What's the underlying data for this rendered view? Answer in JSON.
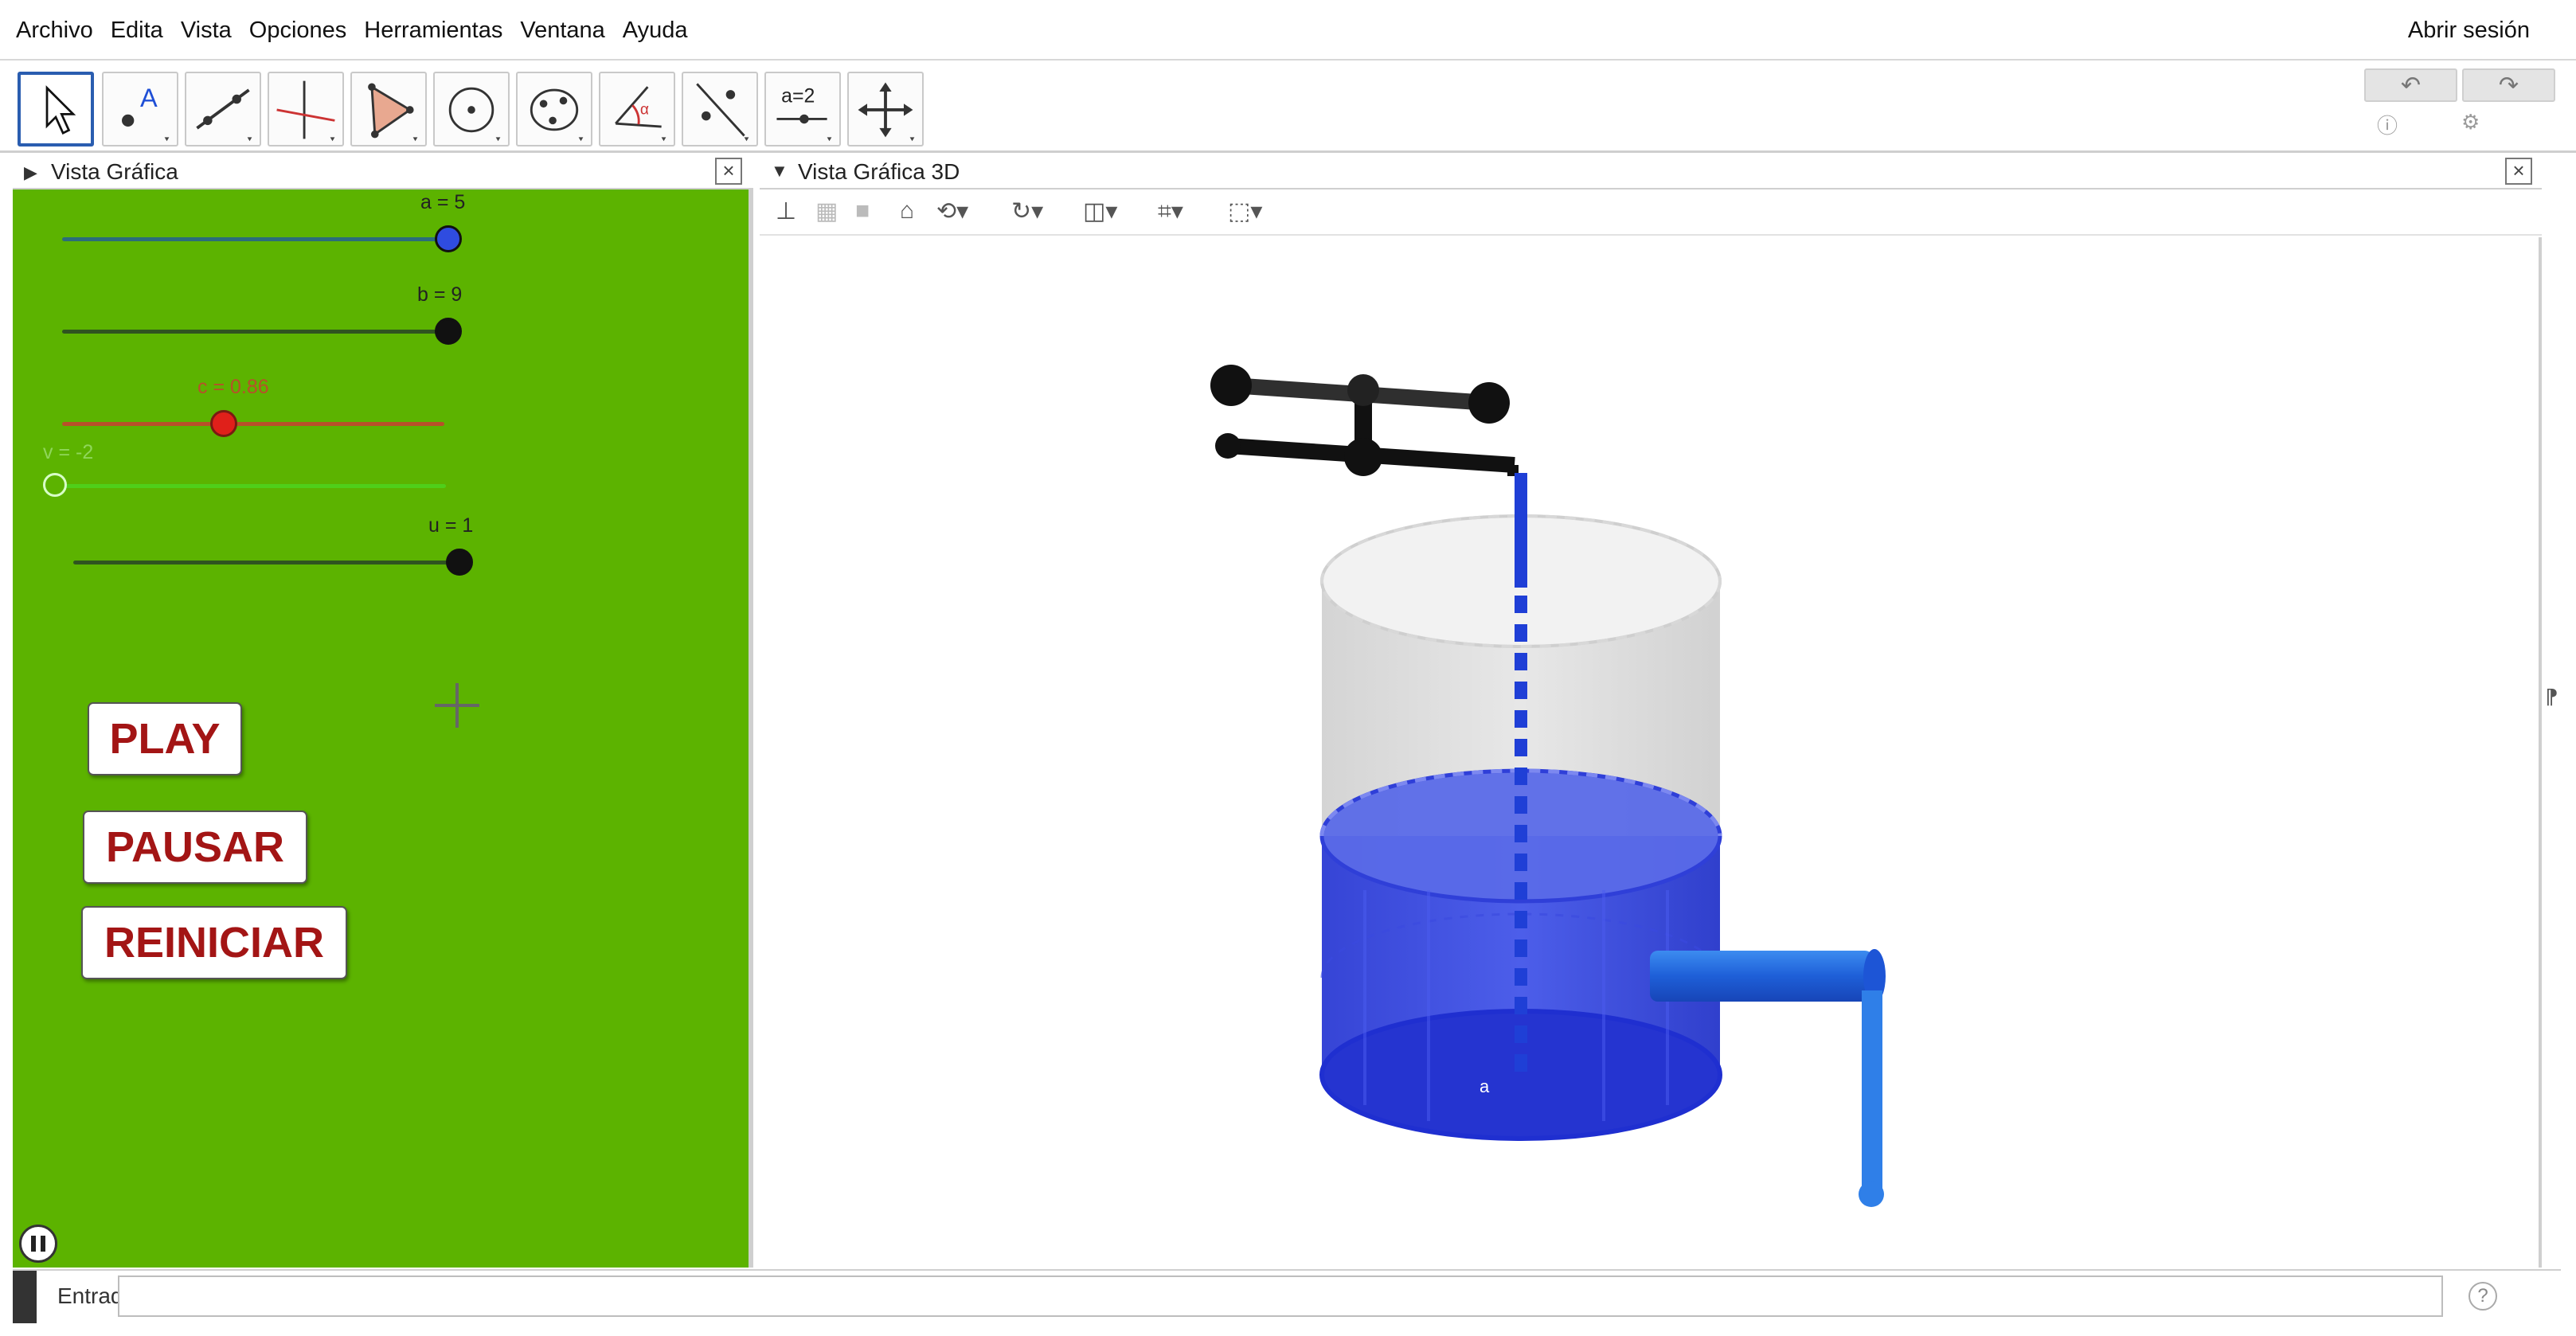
{
  "menu": {
    "items": [
      "Archivo",
      "Edita",
      "Vista",
      "Opciones",
      "Herramientas",
      "Ventana",
      "Ayuda"
    ],
    "login": "Abrir sesión"
  },
  "toolbar": {
    "tools": [
      {
        "icon": "move-arrow-icon",
        "active": true
      },
      {
        "icon": "point-icon"
      },
      {
        "icon": "line-icon"
      },
      {
        "icon": "perpendicular-line-icon"
      },
      {
        "icon": "polygon-icon"
      },
      {
        "icon": "circle-center-icon"
      },
      {
        "icon": "conic-icon"
      },
      {
        "icon": "angle-icon"
      },
      {
        "icon": "reflect-icon"
      },
      {
        "icon": "slider-icon",
        "text": "a=2"
      },
      {
        "icon": "move-view-icon"
      }
    ],
    "undo_icon": "undo-icon",
    "redo_icon": "redo-icon"
  },
  "left_view": {
    "title": "Vista Gráfica",
    "background": "#5cb300",
    "sliders": [
      {
        "label": "a = 5",
        "value": 5,
        "min": 0,
        "max": 5,
        "color": "#2f4ce0",
        "label_color": "#1a3fd1"
      },
      {
        "label": "b = 9",
        "value": 9,
        "min": 0,
        "max": 9,
        "color": "#111111",
        "label_color": "#111111"
      },
      {
        "label": "c = 0.86",
        "value": 0.86,
        "min": 0,
        "max": 2,
        "color": "#e0201a",
        "label_color": "#b8502a"
      },
      {
        "label": "v = -2",
        "value": -2,
        "min": -2,
        "max": 2,
        "color": "#4fcf1a",
        "label_color": "#7ad04a"
      },
      {
        "label": "u = 1",
        "value": 1,
        "min": 0,
        "max": 1,
        "color": "#111111",
        "label_color": "#111111"
      }
    ],
    "buttons": {
      "play": "PLAY",
      "pause": "PAUSAR",
      "reset": "REINICIAR"
    }
  },
  "right_view": {
    "title": "Vista Gráfica 3D",
    "point_label": "a"
  },
  "input_bar": {
    "label": "Entrada",
    "value": ""
  }
}
